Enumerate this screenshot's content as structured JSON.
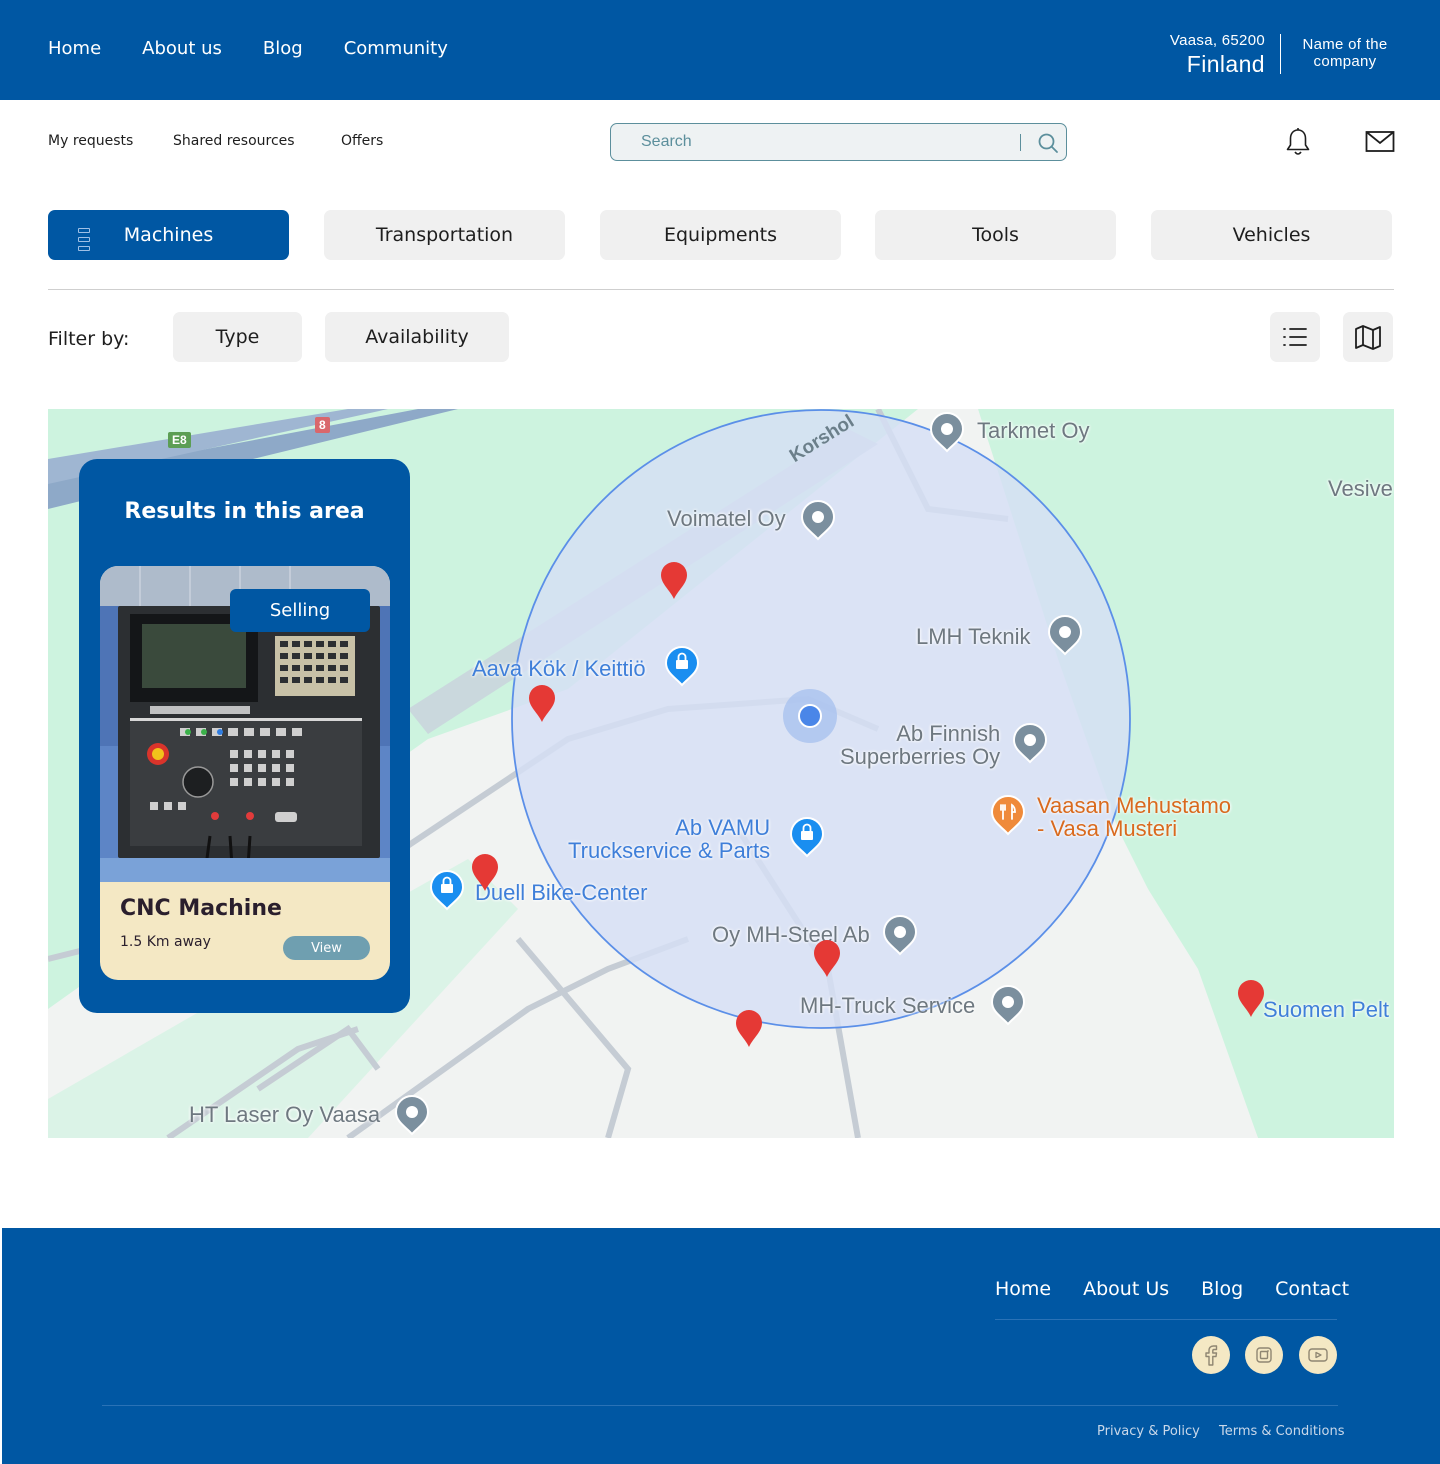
{
  "header": {
    "nav": [
      "Home",
      "About us",
      "Blog",
      "Community"
    ],
    "location_zip": "Vaasa, 65200",
    "location_country": "Finland",
    "company_line1": "Name of the",
    "company_line2": "company"
  },
  "subnav": {
    "items": [
      "My requests",
      "Shared resources",
      "Offers"
    ],
    "search_placeholder": "Search"
  },
  "categories": {
    "active": "Machines",
    "items": [
      "Machines",
      "Transportation",
      "Equipments",
      "Tools",
      "Vehicles"
    ]
  },
  "filters": {
    "label": "Filter by:",
    "buttons": [
      "Type",
      "Availability"
    ],
    "view_modes": [
      "list-view-icon",
      "map-view-icon"
    ]
  },
  "map": {
    "road_shields": [
      "E8",
      "8"
    ],
    "road_name": "Korshol",
    "places": {
      "tarkmet": "Tarkmet Oy",
      "vesive": "Vesive",
      "voimatel": "Voimatel Oy",
      "lmh": "LMH Teknik",
      "aava": "Aava Kök / Keittiö",
      "abfinnish1": "Ab Finnish",
      "abfinnish2": "Superberries Oy",
      "vaasan1": "Vaasan Mehustamo",
      "vaasan2": "- Vasa Musteri",
      "abvamu1": "Ab VAMU",
      "abvamu2": "Truckservice & Parts",
      "duell": "Duell Bike-Center",
      "mhsteel": "Oy MH-Steel Ab",
      "mhtruck": "MH-Truck Service",
      "suomen": "Suomen Pelt",
      "htlaser": "HT Laser Oy Vaasa"
    },
    "colors": {
      "radius_fill": "#d5dff5",
      "radius_stroke": "#5b8fe8",
      "park": "#cdf3df",
      "pin": "#e53935"
    }
  },
  "results": {
    "title": "Results in this area",
    "card": {
      "badge": "Selling",
      "title": "CNC Machine",
      "distance": "1.5 Km away",
      "view_label": "View"
    }
  },
  "footer": {
    "nav": [
      "Home",
      "About Us",
      "Blog",
      "Contact"
    ],
    "social": [
      "facebook-icon",
      "instagram-icon",
      "youtube-icon"
    ],
    "legal": [
      "Privacy & Policy",
      "Terms & Conditions"
    ]
  }
}
